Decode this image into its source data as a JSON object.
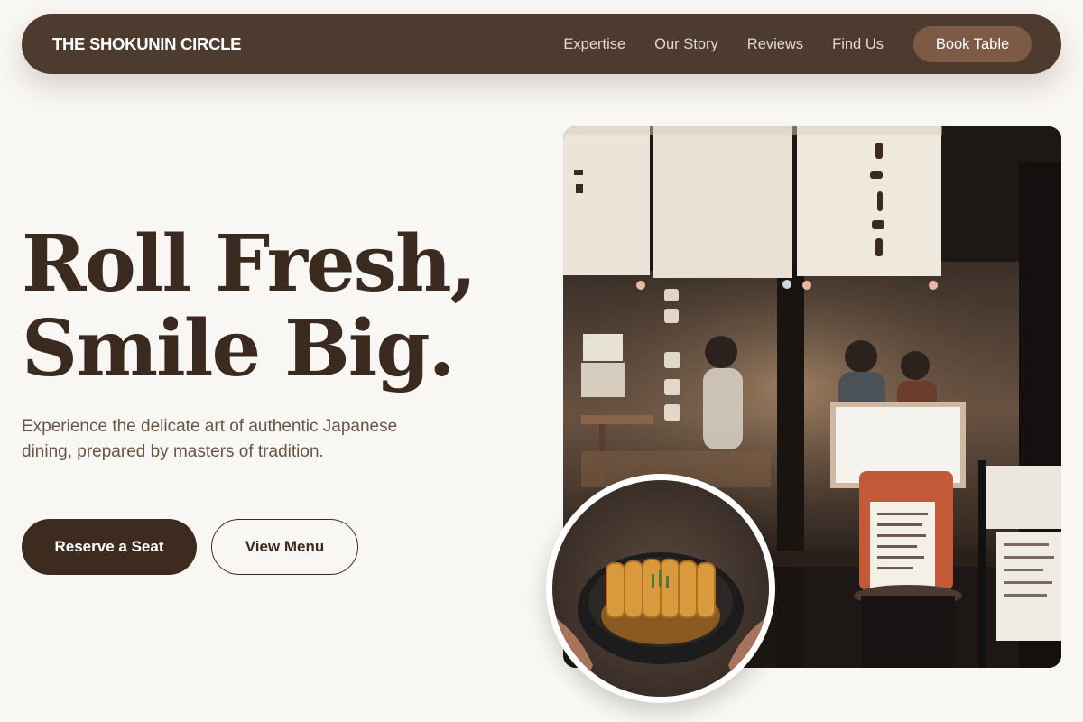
{
  "nav": {
    "brand": "THE SHOKUNIN CIRCLE",
    "links": [
      "Expertise",
      "Our Story",
      "Reviews",
      "Find Us"
    ],
    "cta": "Book Table"
  },
  "hero": {
    "headline_line1": "Roll Fresh,",
    "headline_line2": "Smile Big.",
    "lede": "Experience the delicate art of authentic Japanese dining, prepared by masters of tradition.",
    "primary_cta": "Reserve a Seat",
    "secondary_cta": "View Menu"
  },
  "images": {
    "storefront": "storefront-photo",
    "dish": "katsu-bowl-photo"
  },
  "colors": {
    "background": "#f9f7f3",
    "nav_bg": "#4d3b30",
    "accent": "#7c5a45",
    "text_dark": "#3b2a20",
    "text_muted": "#6a5446"
  }
}
